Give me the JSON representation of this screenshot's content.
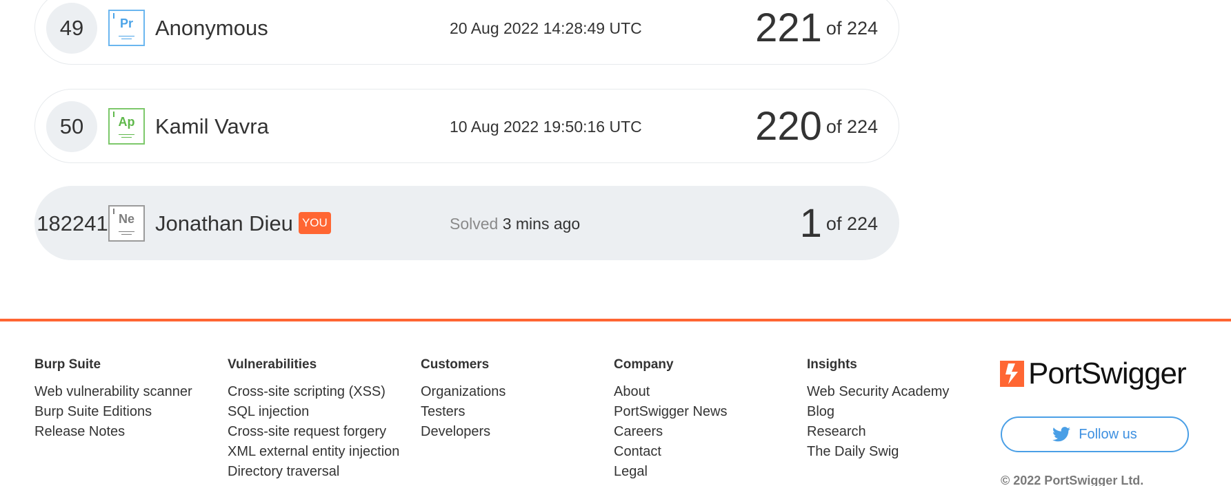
{
  "leaderboard": {
    "rows": [
      {
        "rank": "49",
        "element_symbol": "Pr",
        "name": "Anonymous",
        "date": "20 Aug 2022 14:28:49 UTC",
        "score": "221",
        "of_label": "of 224"
      },
      {
        "rank": "50",
        "element_symbol": "Ap",
        "name": "Kamil Vavra",
        "date": "10 Aug 2022 19:50:16 UTC",
        "score": "220",
        "of_label": "of 224"
      },
      {
        "rank": "182241",
        "element_symbol": "Ne",
        "name": "Jonathan Dieu",
        "badge": "YOU",
        "solved_label": "Solved",
        "solved_value": "3 mins ago",
        "score": "1",
        "of_label": "of 224"
      }
    ]
  },
  "footer": {
    "columns": [
      {
        "heading": "Burp Suite",
        "links": [
          "Web vulnerability scanner",
          "Burp Suite Editions",
          "Release Notes"
        ]
      },
      {
        "heading": "Vulnerabilities",
        "links": [
          "Cross-site scripting (XSS)",
          "SQL injection",
          "Cross-site request forgery",
          "XML external entity injection",
          "Directory traversal"
        ]
      },
      {
        "heading": "Customers",
        "links": [
          "Organizations",
          "Testers",
          "Developers"
        ]
      },
      {
        "heading": "Company",
        "links": [
          "About",
          "PortSwigger News",
          "Careers",
          "Contact",
          "Legal"
        ]
      },
      {
        "heading": "Insights",
        "links": [
          "Web Security Academy",
          "Blog",
          "Research",
          "The Daily Swig"
        ]
      }
    ],
    "brand": {
      "name": "PortSwigger",
      "icon": "portswigger-logo-icon"
    },
    "follow_button": {
      "label": "Follow us",
      "icon": "twitter-icon"
    },
    "copyright": "© 2022 PortSwigger Ltd."
  },
  "colors": {
    "accent": "#ff6633",
    "twitter_blue": "#4a9fe6",
    "row_highlight": "#eceff2"
  }
}
